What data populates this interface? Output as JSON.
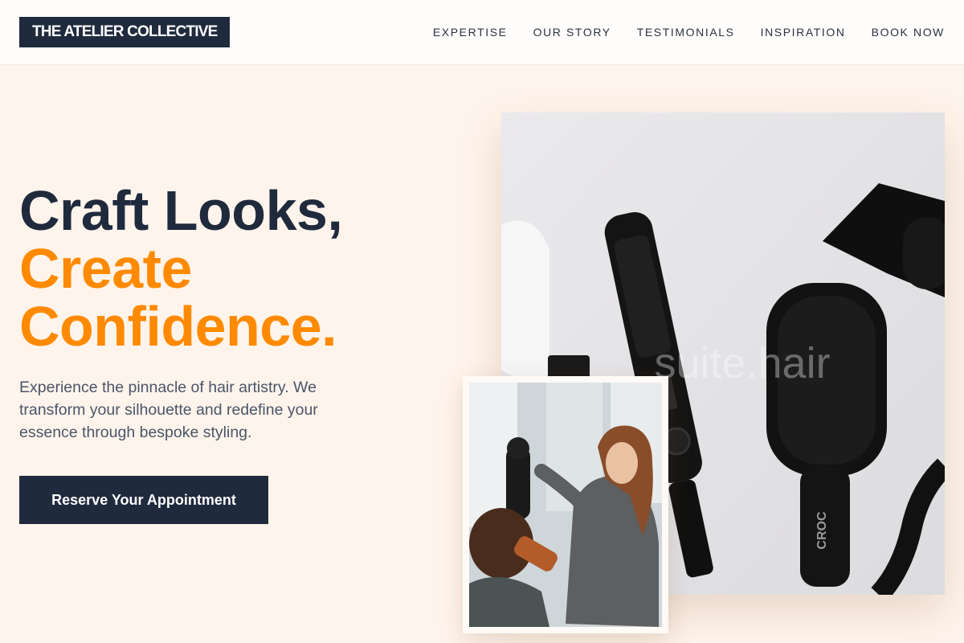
{
  "header": {
    "logo": "THE ATELIER COLLECTIVE",
    "nav": [
      "EXPERTISE",
      "OUR STORY",
      "TESTIMONIALS",
      "INSPIRATION",
      "BOOK NOW"
    ]
  },
  "hero": {
    "title_line1": "Craft Looks,",
    "title_line2": "Create",
    "title_line3": "Confidence.",
    "subtitle": "Experience the pinnacle of hair artistry. We transform your silhouette and redefine your essence through bespoke styling.",
    "cta_label": "Reserve Your Appointment"
  },
  "images": {
    "main_watermark": "suite.hair",
    "brand_mark": "CROC"
  },
  "colors": {
    "navy": "#1f2a3d",
    "accent": "#ff8a00",
    "background": "#fff4ec"
  }
}
